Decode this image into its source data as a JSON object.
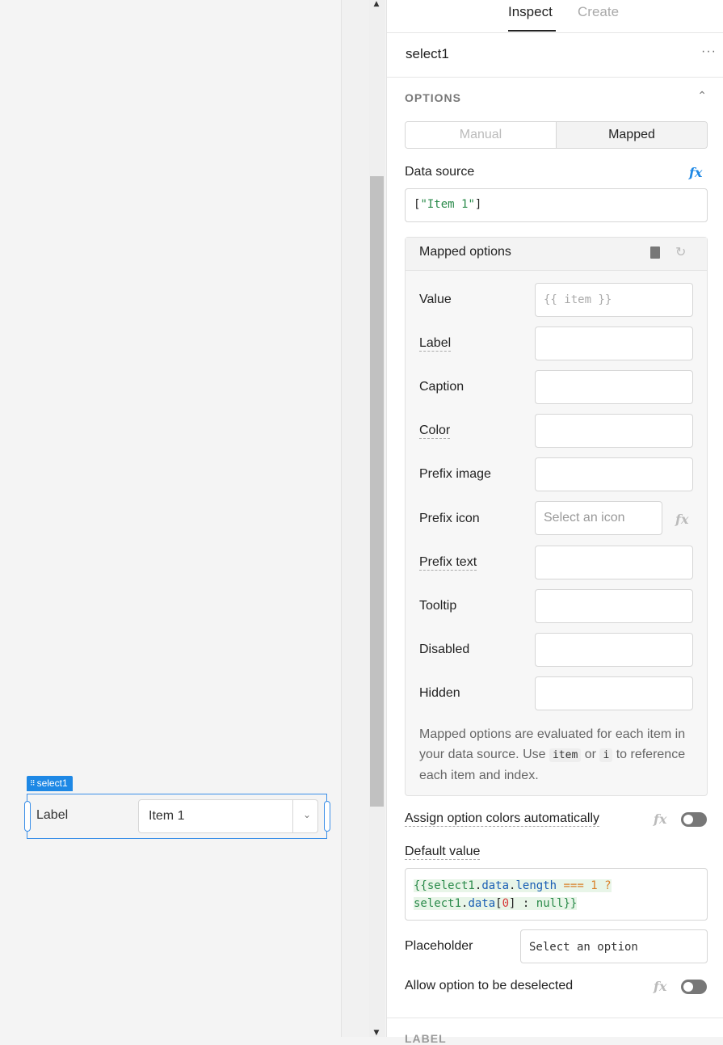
{
  "canvas": {
    "component_tag": "select1",
    "component_label": "Label",
    "component_value": "Item 1"
  },
  "tabs": [
    {
      "label": "Inspect",
      "active": true
    },
    {
      "label": "Create",
      "active": false
    }
  ],
  "inspector": {
    "component_name": "select1",
    "more_icon": "more-horizontal-icon",
    "section_title": "OPTIONS",
    "segment": {
      "manual": "Manual",
      "mapped": "Mapped",
      "selected": "Mapped"
    },
    "data_source_label": "Data source",
    "data_source_value": "[\"Item 1\"]",
    "fx_label": "fx",
    "mapped_options": {
      "title": "Mapped options",
      "rows": [
        {
          "label": "Value",
          "placeholder": "{{ item }}"
        },
        {
          "label": "Label",
          "placeholder": ""
        },
        {
          "label": "Caption",
          "placeholder": ""
        },
        {
          "label": "Color",
          "placeholder": ""
        },
        {
          "label": "Prefix image",
          "placeholder": ""
        },
        {
          "label": "Prefix icon",
          "placeholder": "Select an icon"
        },
        {
          "label": "Prefix text",
          "placeholder": ""
        },
        {
          "label": "Tooltip",
          "placeholder": ""
        },
        {
          "label": "Disabled",
          "placeholder": ""
        },
        {
          "label": "Hidden",
          "placeholder": ""
        }
      ],
      "note_1": "Mapped options are evaluated for each item in your data source. Use",
      "note_kbd_1": "item",
      "note_2": "or",
      "note_kbd_2": "i",
      "note_3": "to reference each item and index."
    },
    "assign_colors_label": "Assign option colors automatically",
    "assign_colors_enabled": false,
    "default_value_label": "Default value",
    "default_value_code": "{{select1.data.length === 1 ? select1.data[0] : null}}",
    "placeholder_label": "Placeholder",
    "placeholder_value": "Select an option",
    "allow_deselect_label": "Allow option to be deselected",
    "allow_deselect_enabled": false,
    "next_section_title": "LABEL"
  }
}
